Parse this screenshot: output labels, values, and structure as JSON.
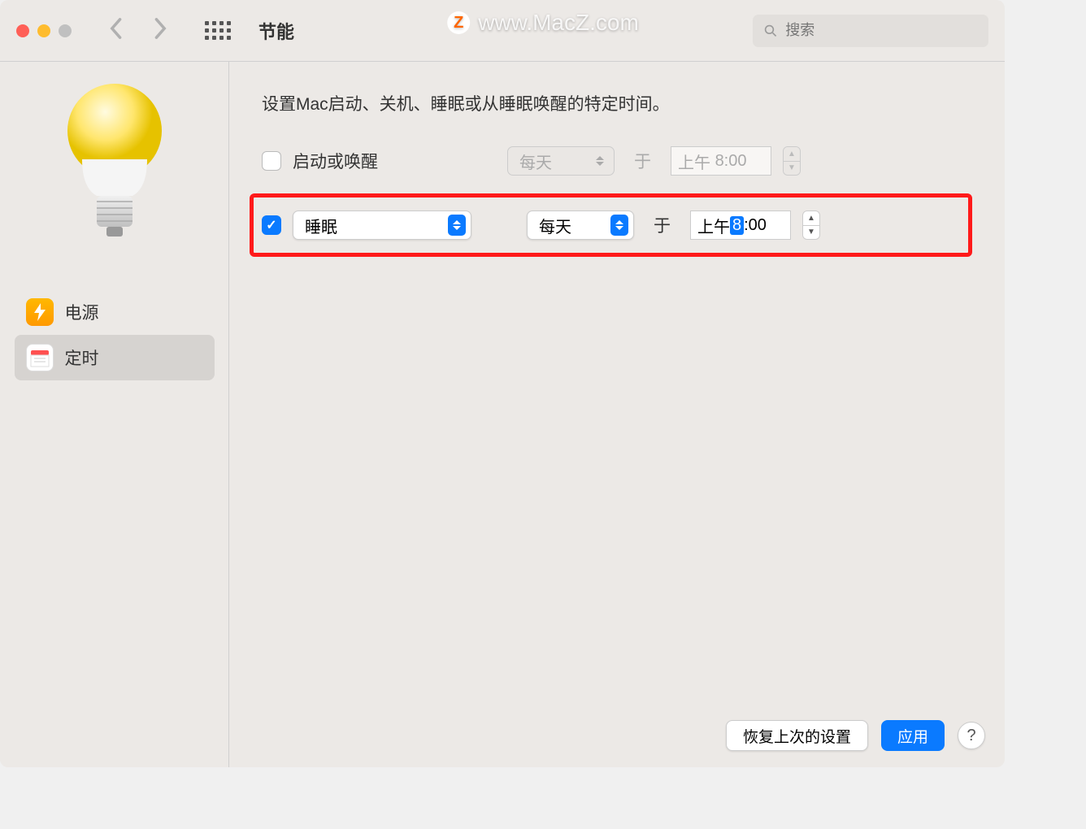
{
  "window": {
    "title": "节能"
  },
  "watermark": {
    "text": "www.MacZ.com",
    "badge": "Z"
  },
  "search": {
    "placeholder": "搜索"
  },
  "sidebar": {
    "items": [
      {
        "label": "电源",
        "icon": "power",
        "selected": false
      },
      {
        "label": "定时",
        "icon": "calendar",
        "selected": true
      }
    ]
  },
  "content": {
    "description": "设置Mac启动、关机、睡眠或从睡眠唤醒的特定时间。",
    "row1": {
      "checked": false,
      "label": "启动或唤醒",
      "frequency": "每天",
      "at": "于",
      "time_prefix": "上午",
      "time_value": "8:00"
    },
    "row2": {
      "checked": true,
      "action": "睡眠",
      "frequency": "每天",
      "at": "于",
      "time_prefix": "上午",
      "time_hour": "8",
      "time_rest": ":00"
    }
  },
  "footer": {
    "restore": "恢复上次的设置",
    "apply": "应用",
    "help": "?"
  }
}
